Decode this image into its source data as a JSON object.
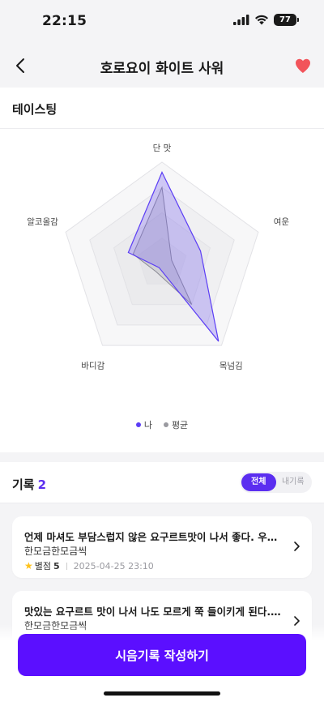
{
  "status": {
    "time": "22:15",
    "battery": "77"
  },
  "nav": {
    "title": "호로요이 화이트 사워"
  },
  "tasting": {
    "title": "테이스팅",
    "chart_data": {
      "type": "radar",
      "axes": [
        "단 맛",
        "여운",
        "목넘김",
        "바디감",
        "알코올감"
      ],
      "series": [
        {
          "name": "나",
          "values": [
            0.9,
            0.4,
            0.95,
            0.05,
            0.35
          ]
        },
        {
          "name": "평균",
          "values": [
            0.75,
            0.1,
            0.5,
            0.1,
            0.3
          ]
        }
      ],
      "rings": 4,
      "colors": {
        "나": "#5b3df5",
        "평균": "#8a8a94"
      }
    },
    "legend": [
      {
        "label": "나",
        "color": "#5b3df5"
      },
      {
        "label": "평균",
        "color": "#9a9aa0"
      }
    ]
  },
  "records": {
    "title": "기록",
    "count": "2",
    "toggle": {
      "all": "전체",
      "mine": "내기록"
    },
    "items": [
      {
        "text": "언제 마셔도 부담스럽지 않은 요구르트맛이 나서 좋다. 우연히 편의점에서 보고",
        "author": "한모금한모금씩",
        "rating_label": "별점",
        "rating": "5",
        "date": "2025-04-25 23:10"
      },
      {
        "text": "맛있는 요구르트 맛이 나서 나도 모르게 쭉 들이키게 된다. 아무리 마셔도",
        "author": "한모금한모금씩"
      }
    ]
  },
  "cta": {
    "label": "시음기록 작성하기"
  }
}
